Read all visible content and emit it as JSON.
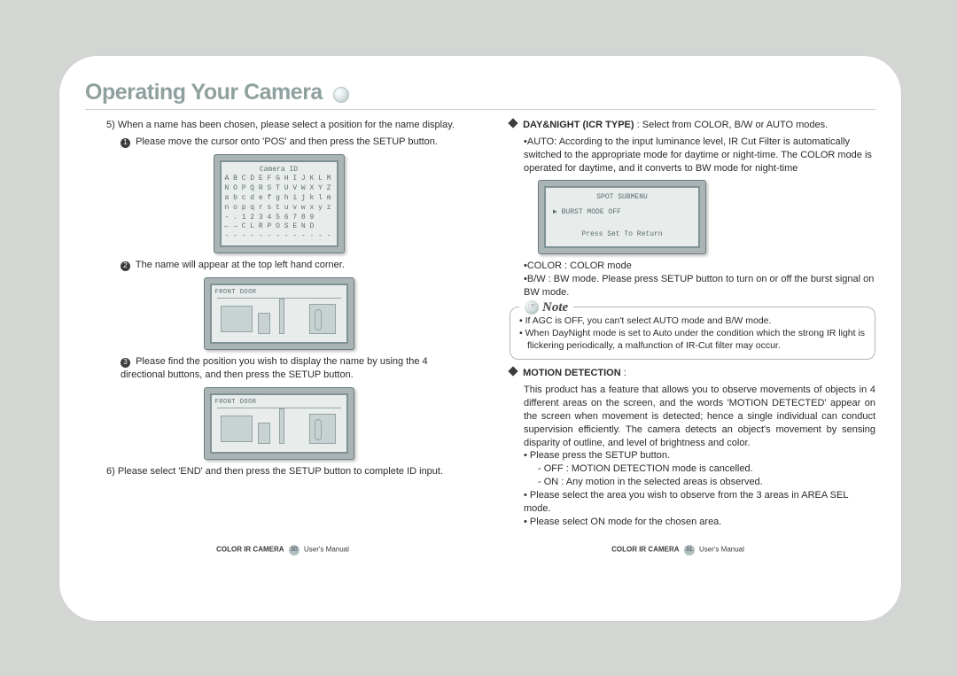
{
  "header": {
    "title": "Operating Your Camera"
  },
  "left": {
    "step5": "5) When a name has been chosen, please select a position for the name display.",
    "step5a": "Please move the cursor onto 'POS' and then press the SETUP button.",
    "osd": {
      "t": "Camera ID",
      "l1": "A B C D E F G H I J K L M",
      "l2": "N O P Q R S T U V W X Y Z",
      "l3": "a b c d e f g h i j k l m",
      "l4": "n o p q r s t u v w x y z",
      "l5": "- .   1 2 3 4 5 6 7 8 9",
      "l6": "← →   C L R   P O S   E N D",
      "l7": "- - - - - - - - - - - - -"
    },
    "step5b": "The name will appear at the top left hand corner.",
    "camlabel": "FRONT DOOR",
    "step5c": "Please find the position you wish to display the name by using the 4 directional buttons, and then press the SETUP button.",
    "step6": "6) Please select 'END' and then press the SETUP button to complete ID input."
  },
  "right": {
    "daynight_label": "DAY&NIGHT (ICR TYPE)",
    "daynight_text": " : Select from COLOR, B/W or AUTO modes.",
    "auto": "•AUTO: According to the input luminance level, IR Cut Filter is automatically switched to the appropriate mode for daytime or night-time. The COLOR mode is operated for daytime, and it converts to BW mode for night-time",
    "osd": {
      "t": "SPOT SUBMENU",
      "row": "▶ BURST MODE        OFF",
      "ret": "Press Set To Return"
    },
    "color": "•COLOR : COLOR mode",
    "bw": "•B/W : BW mode. Please press SETUP button to turn on or off the burst signal on BW mode.",
    "note1": "If AGC is OFF, you can't select AUTO mode and B/W mode.",
    "note2": "When DayNight mode is set to Auto under the condition which the strong IR light is flickering periodically, a malfunction of IR-Cut filter may occur.",
    "note_title": "Note",
    "md_label": "MOTION DETECTION",
    "md_colon": " :",
    "md_desc": "This product has a feature that allows you to observe movements of objects in 4 different areas on the screen, and the words 'MOTION DETECTED' appear on the screen when movement is detected; hence a single individual can conduct supervision efficiently. The camera detects an object's movement by sensing disparity of outline, and level of brightness and color.",
    "md_b1": "• Please press the SETUP button.",
    "md_b1a": "- OFF : MOTION DETECTION mode is cancelled.",
    "md_b1b": "- ON : Any motion in the selected areas is observed.",
    "md_b2": "• Please select the area you wish to observe from the 3 areas in AREA SEL mode.",
    "md_b3": "• Please select ON mode for the chosen area."
  },
  "footer": {
    "line": "COLOR IR CAMERA",
    "suffix": "User's Manual",
    "pgL": "30",
    "pgR": "31"
  }
}
